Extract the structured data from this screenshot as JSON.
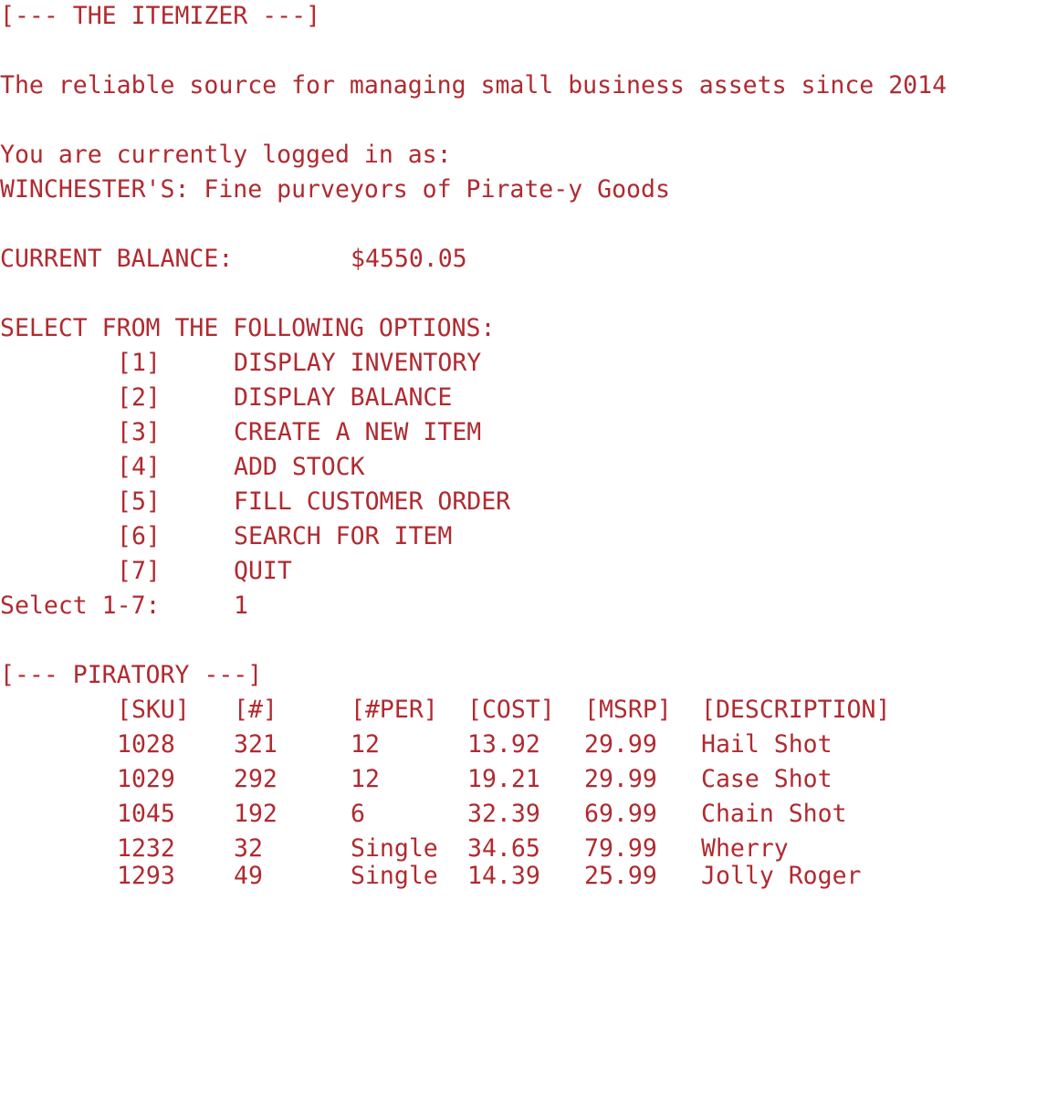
{
  "app": {
    "header": "[--- THE ITEMIZER ---]",
    "tagline": "The reliable source for managing small business assets since 2014",
    "logged_in_label": "You are currently logged in as:",
    "logged_in_user": "WINCHESTER'S: Fine purveyors of Pirate-y Goods",
    "balance_label": "CURRENT BALANCE:",
    "balance_value": "$4550.05",
    "text_color": "#b02a30",
    "background_color": "#ffffff"
  },
  "menu": {
    "prompt": "SELECT FROM THE FOLLOWING OPTIONS:",
    "options": [
      {
        "key": "[1]",
        "label": "DISPLAY INVENTORY"
      },
      {
        "key": "[2]",
        "label": "DISPLAY BALANCE"
      },
      {
        "key": "[3]",
        "label": "CREATE A NEW ITEM"
      },
      {
        "key": "[4]",
        "label": "ADD STOCK"
      },
      {
        "key": "[5]",
        "label": "FILL CUSTOMER ORDER"
      },
      {
        "key": "[6]",
        "label": "SEARCH FOR ITEM"
      },
      {
        "key": "[7]",
        "label": "QUIT"
      }
    ],
    "select_prompt": "Select 1-7:",
    "select_value": "1"
  },
  "inventory": {
    "header": "[--- PIRATORY ---]",
    "columns": [
      "[SKU]",
      "[#]",
      "[#PER]",
      "[COST]",
      "[MSRP]",
      "[DESCRIPTION]"
    ],
    "rows": [
      [
        "1028",
        "321",
        "12",
        "13.92",
        "29.99",
        "Hail Shot"
      ],
      [
        "1029",
        "292",
        "12",
        "19.21",
        "29.99",
        "Case Shot"
      ],
      [
        "1045",
        "192",
        "6",
        "32.39",
        "69.99",
        "Chain Shot"
      ],
      [
        "1232",
        "32",
        "Single",
        "34.65",
        "79.99",
        "Wherry"
      ],
      [
        "1293",
        "49",
        "Single",
        "14.39",
        "25.99",
        "Jolly Roger"
      ]
    ]
  }
}
